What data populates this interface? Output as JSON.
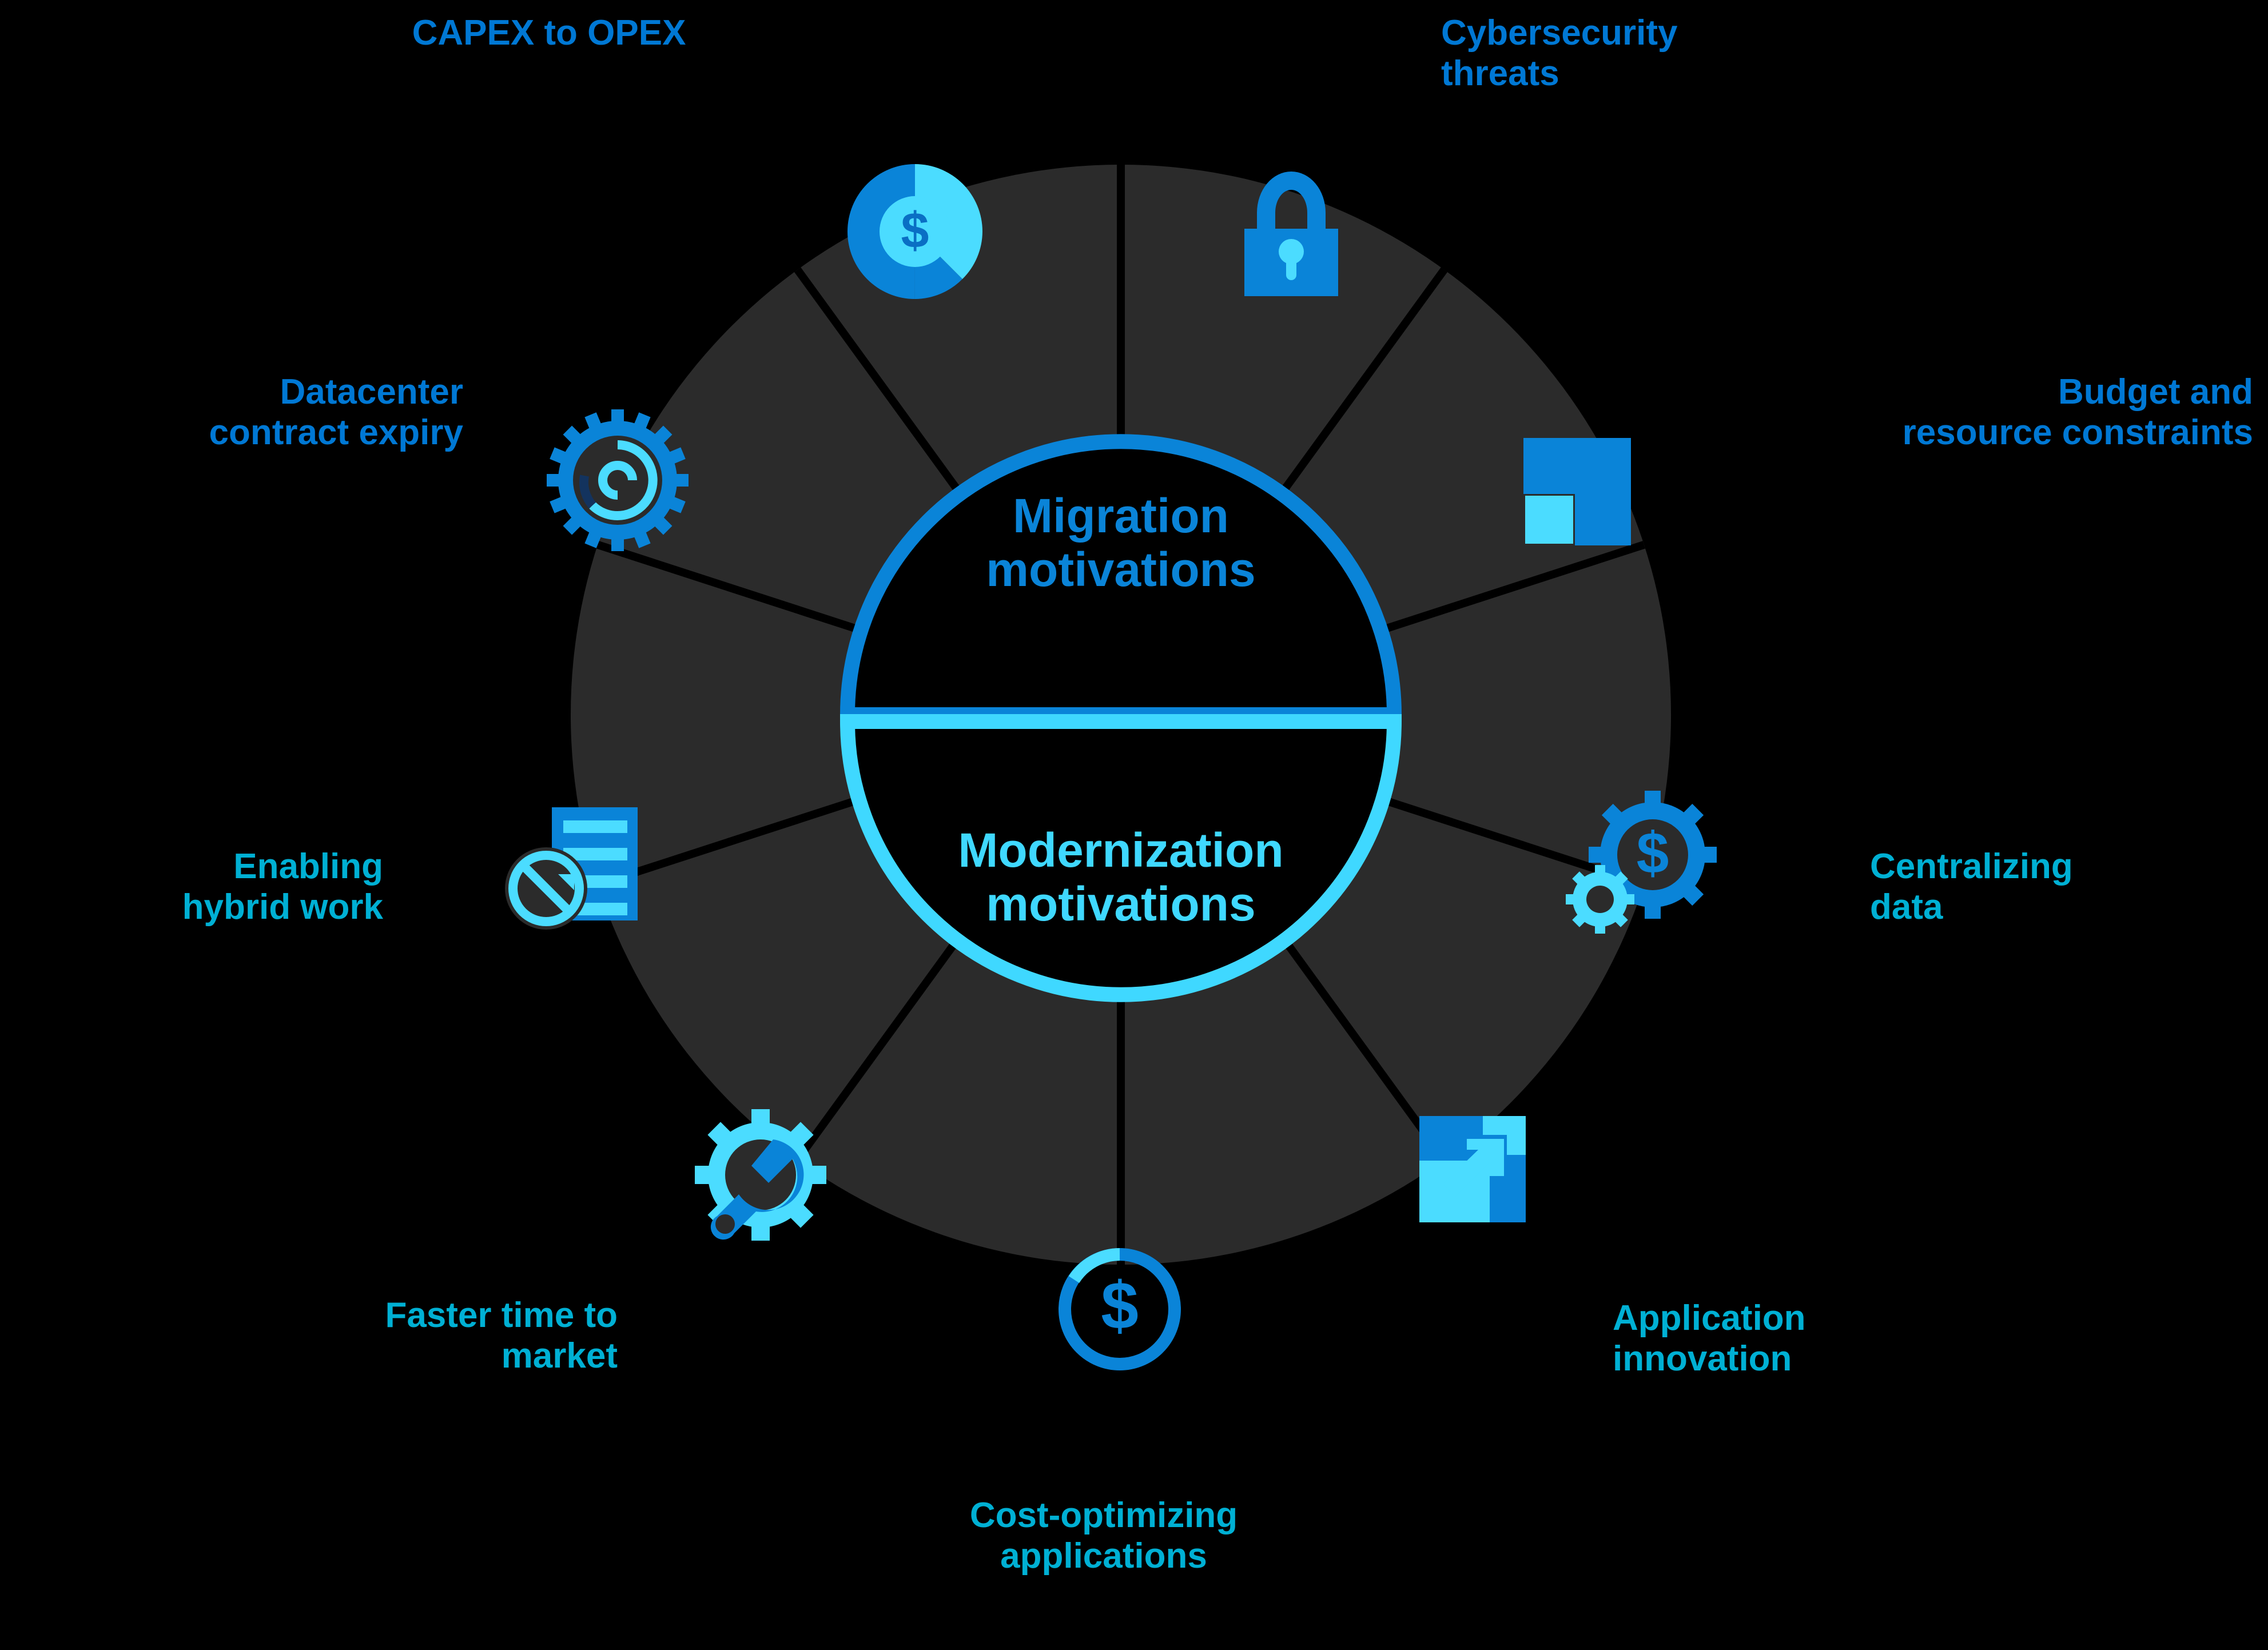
{
  "colors": {
    "background": "#000000",
    "segment_fill": "#2B2B2B",
    "divider": "#000000",
    "migration_blue": "#0078D4",
    "modernization_cyan": "#00B0D4",
    "icon_blue": "#0A84D8",
    "icon_cyan": "#4BDCFF",
    "center_ring_top": "#0A84D8",
    "center_ring_bottom": "#3FD8FF"
  },
  "center": {
    "top_label": "Migration\nmotivations",
    "bottom_label": "Modernization\nmotivations"
  },
  "segments": [
    {
      "id": "capex-to-opex",
      "label": "CAPEX to OPEX",
      "group": "migration",
      "icon": "dollar-donut-chart-icon"
    },
    {
      "id": "cybersecurity-threats",
      "label": "Cybersecurity\nthreats",
      "group": "migration",
      "icon": "padlock-icon"
    },
    {
      "id": "budget-resource",
      "label": "Budget and\nresource constraints",
      "group": "migration",
      "icon": "nested-squares-icon"
    },
    {
      "id": "centralizing-data",
      "label": "Centralizing\ndata",
      "group": "modernization",
      "icon": "dollar-gears-icon"
    },
    {
      "id": "application-innovation",
      "label": "Application\ninnovation",
      "group": "modernization",
      "icon": "arrow-up-right-square-icon"
    },
    {
      "id": "cost-optimizing-apps",
      "label": "Cost-optimizing\napplications",
      "group": "modernization",
      "icon": "dollar-ring-icon"
    },
    {
      "id": "faster-time-to-market",
      "label": "Faster time to\nmarket",
      "group": "modernization",
      "icon": "gear-wrench-icon"
    },
    {
      "id": "enabling-hybrid-work",
      "label": "Enabling\nhybrid work",
      "group": "modernization",
      "icon": "document-refresh-icon"
    },
    {
      "id": "datacenter-contract-expiry",
      "label": "Datacenter\ncontract expiry",
      "group": "migration",
      "icon": "gear-spiral-icon"
    }
  ],
  "chart_data": {
    "type": "pie",
    "title": "Migration motivations / Modernization motivations",
    "categories": [
      "CAPEX to OPEX",
      "Cybersecurity threats",
      "Budget and resource constraints",
      "Centralizing data",
      "Application innovation",
      "Cost-optimizing applications",
      "Faster time to market",
      "Enabling hybrid work",
      "Datacenter contract expiry"
    ],
    "values": [
      10,
      10,
      10,
      10,
      10,
      10,
      10,
      10,
      10
    ],
    "legend": [
      "Migration motivations",
      "Modernization motivations"
    ],
    "note": "Ten equal radial segments around a split hub"
  }
}
